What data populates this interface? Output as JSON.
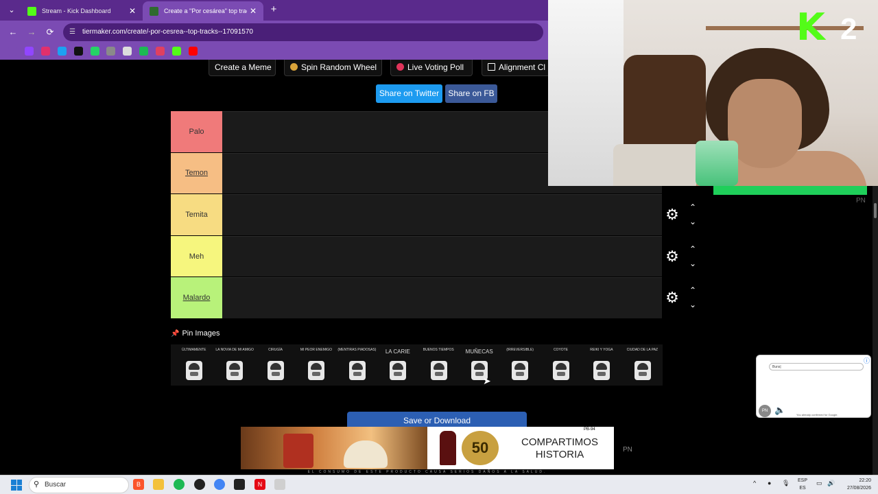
{
  "browser": {
    "tabs": [
      {
        "title": "Stream - Kick Dashboard",
        "close": "✕",
        "favicon_color": "#53fc18"
      },
      {
        "title": "Create a \"Por cesárea\" top tracks Ti",
        "close": "✕",
        "favicon_color": "#2f6a2f"
      }
    ],
    "new_tab": "+",
    "tab_dropdown": "⌄",
    "url": "tiermaker.com/create/-por-cesrea--top-tracks--17091570",
    "back": "←",
    "forward": "→",
    "reload": "⟳",
    "bookmarks": [
      {
        "icon": "apps-grid-icon",
        "color": "#7b4bb3"
      },
      {
        "icon": "twitch-icon",
        "color": "#9146ff"
      },
      {
        "icon": "instagram-icon",
        "color": "#e1306c"
      },
      {
        "icon": "twitter-icon",
        "color": "#1da1f2"
      },
      {
        "icon": "tiktok-icon",
        "color": "#111111"
      },
      {
        "icon": "whatsapp-icon",
        "color": "#25d366"
      },
      {
        "icon": "gamepad-icon",
        "color": "#8a8a8a"
      },
      {
        "icon": "chrome-icon",
        "color": "#dddddd"
      },
      {
        "icon": "spotify-icon",
        "color": "#1db954"
      },
      {
        "icon": "media-icon",
        "color": "#e04060"
      },
      {
        "icon": "kick-icon",
        "color": "#53fc18"
      },
      {
        "icon": "youtube-icon",
        "color": "#ff0000"
      }
    ]
  },
  "page": {
    "top_buttons": [
      {
        "label": "Create a Meme",
        "icon_color": ""
      },
      {
        "label": "Spin Random Wheel",
        "icon_color": "#d9a43a"
      },
      {
        "label": "Live Voting Poll",
        "icon_color": "#e0345a"
      },
      {
        "label": "Alignment Cl",
        "icon_color": "#ffffff"
      }
    ],
    "share_twitter": "Share on Twitter",
    "share_fb": "Share on FB",
    "tiers": [
      {
        "label": "Palo",
        "color": "#f07a7a",
        "underline": false
      },
      {
        "label": "Temon",
        "color": "#f6be84",
        "underline": true
      },
      {
        "label": "Temita",
        "color": "#f7dc82",
        "underline": false
      },
      {
        "label": "Meh",
        "color": "#f6f67e",
        "underline": false
      },
      {
        "label": "Malardo",
        "color": "#b8f27a",
        "underline": true
      }
    ],
    "gear": "⚙",
    "up": "⌃",
    "down": "⌄",
    "pin_label": "Pin Images",
    "pin_icon": "📌",
    "tracks": [
      {
        "name": "ÚLTIMAMENTE",
        "big": false
      },
      {
        "name": "LA NOVIA DE MI AMIGO",
        "big": false
      },
      {
        "name": "CIRUGÍA",
        "big": false
      },
      {
        "name": "MI PEOR ENEMIGO",
        "big": false
      },
      {
        "name": "(MENTIRAS PIADOSAS)",
        "big": false
      },
      {
        "name": "LA CARIE",
        "big": true
      },
      {
        "name": "BUENOS TIEMPOS",
        "big": false
      },
      {
        "name": "MUÑECAS",
        "big": true
      },
      {
        "name": "(IRREVERSIBLE)",
        "big": false
      },
      {
        "name": "COYOTE",
        "big": false
      },
      {
        "name": "REIKI Y YOGA",
        "big": false
      },
      {
        "name": "CIUDAD DE LA PAZ",
        "big": false
      }
    ],
    "save": "Save or Download"
  },
  "ad": {
    "seal": "50",
    "text": "COMPARTIMOS HISTORIA",
    "tag": "PB-94",
    "footer": "EL CONSUMO DE ESTE PRODUCTO CAUSA SERIOS DAÑOS A LA SALUD."
  },
  "overlay": {
    "pn_mid": "PN",
    "pn_right": "PN",
    "kick_logo": "K",
    "kick_num": "2",
    "mini_search": "Buns|",
    "mini_pn": "PN",
    "mini_note": "You already confirmed for Google."
  },
  "taskbar": {
    "search": "Buscar",
    "lang": "ESP\nES",
    "time": "22:20",
    "date": "27/08/2026"
  }
}
